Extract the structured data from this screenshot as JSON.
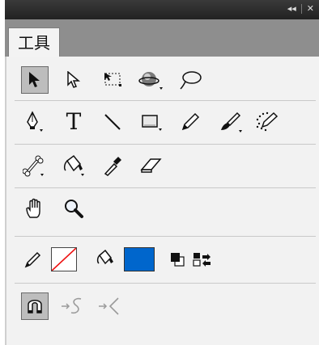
{
  "panel": {
    "title_buttons": {
      "collapse": "◂◂",
      "close": "✕"
    },
    "tab_label": "工具"
  },
  "colors": {
    "fill": "#0066cc",
    "stroke": "none"
  },
  "tools": [
    "selection-tool",
    "subselection-tool",
    "free-transform-tool",
    "3d-rotation-tool",
    "lasso-tool",
    "pen-tool",
    "text-tool",
    "line-tool",
    "rectangle-tool",
    "pencil-tool",
    "brush-tool",
    "deco-tool",
    "bone-tool",
    "paint-bucket-tool",
    "eyedropper-tool",
    "eraser-tool",
    "hand-tool",
    "zoom-tool",
    "stroke-color",
    "fill-color",
    "black-and-white",
    "swap-colors",
    "snap-to-objects",
    "smooth",
    "straighten"
  ],
  "text_tool_glyph": "T"
}
